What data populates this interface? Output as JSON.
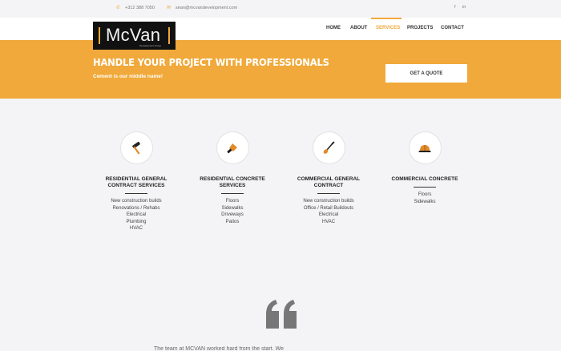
{
  "topbar": {
    "phone": "+312 388 7050",
    "email": "sean@mcvandevelopment.com",
    "social": [
      "f",
      "in"
    ]
  },
  "logo": {
    "name": "McVan",
    "tagline": "Development Group"
  },
  "nav": {
    "items": [
      "HOME",
      "ABOUT",
      "SERVICES",
      "PROJECTS",
      "CONTACT"
    ],
    "active": "SERVICES"
  },
  "banner": {
    "headline": "HANDLE YOUR PROJECT WITH PROFESSIONALS",
    "subline": "Cement is our middle name!",
    "cta": "GET A QUOTE"
  },
  "services": [
    {
      "icon": "hammer-icon",
      "title": "RESIDENTIAL GENERAL CONTRACT SERVICES",
      "items": [
        "New construction builds",
        "Renovations / Rehabs",
        "Electrical",
        "Plumbing",
        "HVAC"
      ]
    },
    {
      "icon": "trowel-icon",
      "title": "RESIDENTIAL CONCRETE SERVICES",
      "items": [
        "Floors",
        "Sidewalks",
        "Driveways",
        "Patios"
      ]
    },
    {
      "icon": "shovel-icon",
      "title": "COMMERCIAL GENERAL CONTRACT",
      "items": [
        "New construction builds",
        "Office / Retail Buildouts",
        "Electrical",
        "HVAC"
      ]
    },
    {
      "icon": "hard-hat-icon",
      "title": "COMMERCIAL CONCRETE",
      "items": [
        "Floors",
        "Sidewalks"
      ]
    }
  ],
  "testimonial": {
    "partial_text": "The team at MCVAN worked hard from the start. We"
  },
  "colors": {
    "accent": "#f0a93a",
    "background": "#f4f4f6"
  }
}
